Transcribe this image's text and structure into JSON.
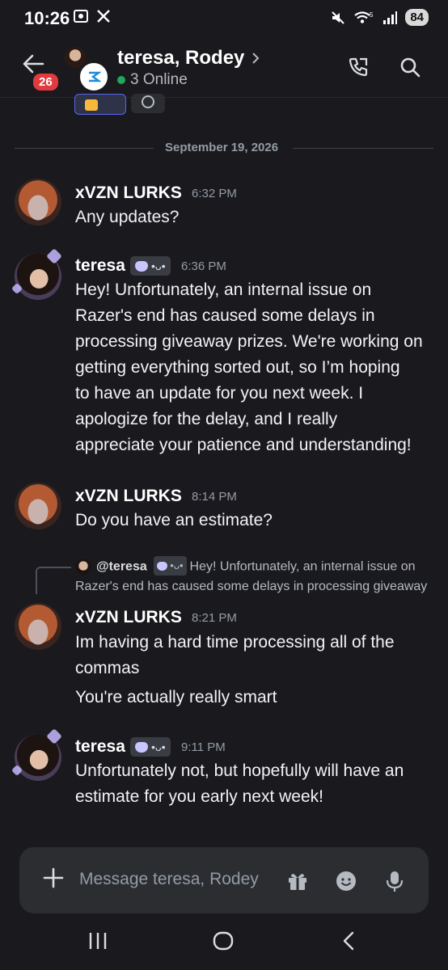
{
  "status_bar": {
    "time": "10:26",
    "battery": "84",
    "signal_label": "5"
  },
  "header": {
    "back_badge": "26",
    "title": "teresa, Rodey",
    "online": "3 Online"
  },
  "date_divider": "September 19, 2026",
  "messages": [
    {
      "author": "xVZN LURKS",
      "time": "6:32 PM",
      "lines": [
        "Any updates?"
      ]
    },
    {
      "author": "teresa",
      "tag": "•ᴗ•",
      "time": "6:36 PM",
      "lines": [
        "Hey! Unfortunately, an internal issue on",
        "Razer's end has caused some delays in",
        "processing giveaway prizes. We're working on",
        "getting everything sorted out, so I’m hoping",
        "to have an update for you next week. I",
        "apologize for the delay, and I really",
        "appreciate your patience and understanding!"
      ]
    },
    {
      "author": "xVZN LURKS",
      "time": "8:14 PM",
      "lines": [
        "Do you have an estimate?"
      ]
    },
    {
      "author": "xVZN LURKS",
      "time": "8:21 PM",
      "reply": {
        "mention": "@teresa",
        "tag": "•ᴗ•",
        "line1": "Hey! Unfortunately, an internal issue on",
        "line2": "Razer's end has caused some delays in processing giveaway"
      },
      "lines": [
        "Im having a hard time processing all of the",
        "commas"
      ],
      "extra": "You're actually really smart"
    },
    {
      "author": "teresa",
      "tag": "•ᴗ•",
      "time": "9:11 PM",
      "lines": [
        "Unfortunately not, but hopefully will have an",
        "estimate for you early next week!"
      ]
    }
  ],
  "composer": {
    "placeholder": "Message teresa, Rodey"
  },
  "icons": [
    "back-arrow-icon",
    "call-icon",
    "search-icon",
    "plus-icon",
    "gift-icon",
    "emoji-icon",
    "mic-icon",
    "recents-icon",
    "home-icon",
    "back-nav-icon"
  ]
}
